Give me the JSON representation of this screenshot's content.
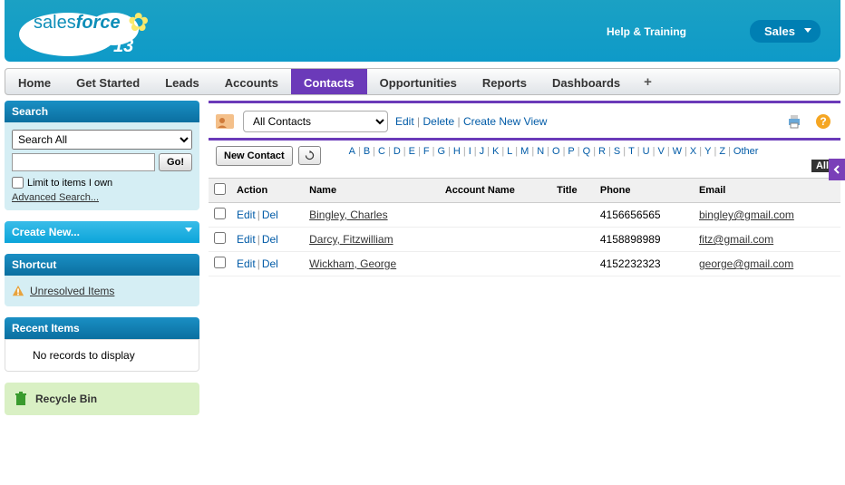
{
  "header": {
    "brand_sales": "sales",
    "brand_force": "force",
    "brand_num": "13",
    "help_training": "Help & Training",
    "app_label": "Sales"
  },
  "nav": {
    "home": "Home",
    "get_started": "Get Started",
    "leads": "Leads",
    "accounts": "Accounts",
    "contacts": "Contacts",
    "opportunities": "Opportunities",
    "reports": "Reports",
    "dashboards": "Dashboards",
    "plus": "+"
  },
  "sidebar": {
    "search_title": "Search",
    "search_select": "Search All",
    "go_label": "Go!",
    "limit_label": "Limit to items I own",
    "advanced_label": "Advanced Search...",
    "create_new": "Create New...",
    "shortcut_title": "Shortcut",
    "unresolved": "Unresolved Items",
    "recent_title": "Recent Items",
    "recent_empty": "No records to display",
    "recycle": "Recycle Bin"
  },
  "view": {
    "selected": "All Contacts",
    "edit": "Edit",
    "delete": "Delete",
    "create_new_view": "Create New View",
    "new_contact_btn": "New Contact"
  },
  "alpha": [
    "A",
    "B",
    "C",
    "D",
    "E",
    "F",
    "G",
    "H",
    "I",
    "J",
    "K",
    "L",
    "M",
    "N",
    "O",
    "P",
    "Q",
    "R",
    "S",
    "T",
    "U",
    "V",
    "W",
    "X",
    "Y",
    "Z",
    "Other"
  ],
  "alpha_all": "All",
  "columns": {
    "action": "Action",
    "name": "Name",
    "account": "Account Name",
    "title": "Title",
    "phone": "Phone",
    "email": "Email"
  },
  "row_actions": {
    "edit": "Edit",
    "del": "Del"
  },
  "rows": [
    {
      "name": "Bingley, Charles",
      "account": "",
      "title": "",
      "phone": "4156656565",
      "email": "bingley@gmail.com"
    },
    {
      "name": "Darcy, Fitzwilliam",
      "account": "",
      "title": "",
      "phone": "4158898989",
      "email": "fitz@gmail.com"
    },
    {
      "name": "Wickham, George",
      "account": "",
      "title": "",
      "phone": "4152232323",
      "email": "george@gmail.com"
    }
  ]
}
